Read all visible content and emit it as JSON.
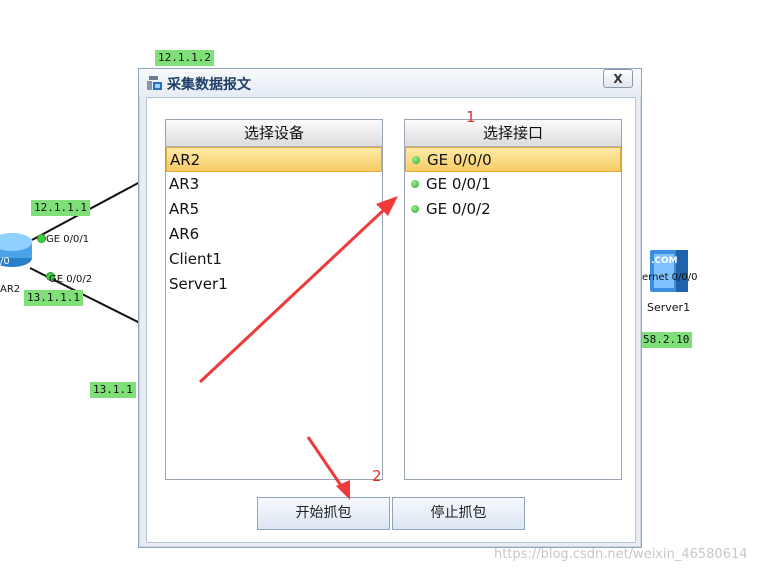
{
  "topology": {
    "ip_labels": [
      "12.1.1.2",
      "12.1.1.1",
      "13.1.1.1",
      "13.1.1",
      "58.2.10"
    ],
    "router": {
      "name": "AR2",
      "port_partial": "/0",
      "ports": [
        "GE 0/0/1",
        "GE 0/0/2"
      ]
    },
    "server": {
      "name": "Server1",
      "port": "ernet 0/0/0",
      "badge": ".COM"
    }
  },
  "dialog": {
    "title": "采集数据报文",
    "close_label": "X",
    "device_panel": {
      "header": "选择设备",
      "items": [
        "AR2",
        "AR3",
        "AR5",
        "AR6",
        "Client1",
        "Server1"
      ],
      "selected_index": 0
    },
    "interface_panel": {
      "header": "选择接口",
      "items": [
        "GE 0/0/0",
        "GE 0/0/1",
        "GE 0/0/2"
      ],
      "selected_index": 0
    },
    "start_button": "开始抓包",
    "stop_button": "停止抓包"
  },
  "annotations": {
    "step1": "1",
    "step2": "2",
    "color": "#e03030"
  },
  "watermark": "https://blog.csdn.net/weixin_46580614"
}
